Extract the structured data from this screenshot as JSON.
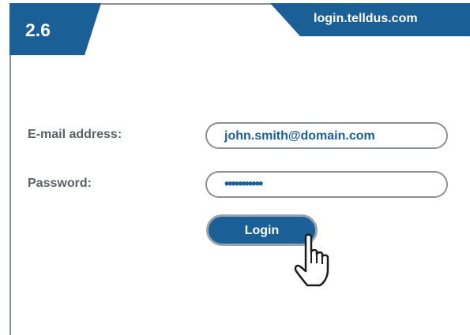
{
  "step": {
    "number": "2.6"
  },
  "url_tab": {
    "text": "login.telldus.com"
  },
  "form": {
    "email_label": "E-mail address:",
    "email_value": "john.smith@domain.com",
    "password_label": "Password:",
    "password_value": "•••••••••••",
    "login_label": "Login"
  },
  "colors": {
    "brand_blue": "#1a5f95",
    "label_gray": "#5d5f62",
    "border_gray": "#8c8f93"
  },
  "cursor": {
    "icon": "hand-pointer-icon"
  }
}
